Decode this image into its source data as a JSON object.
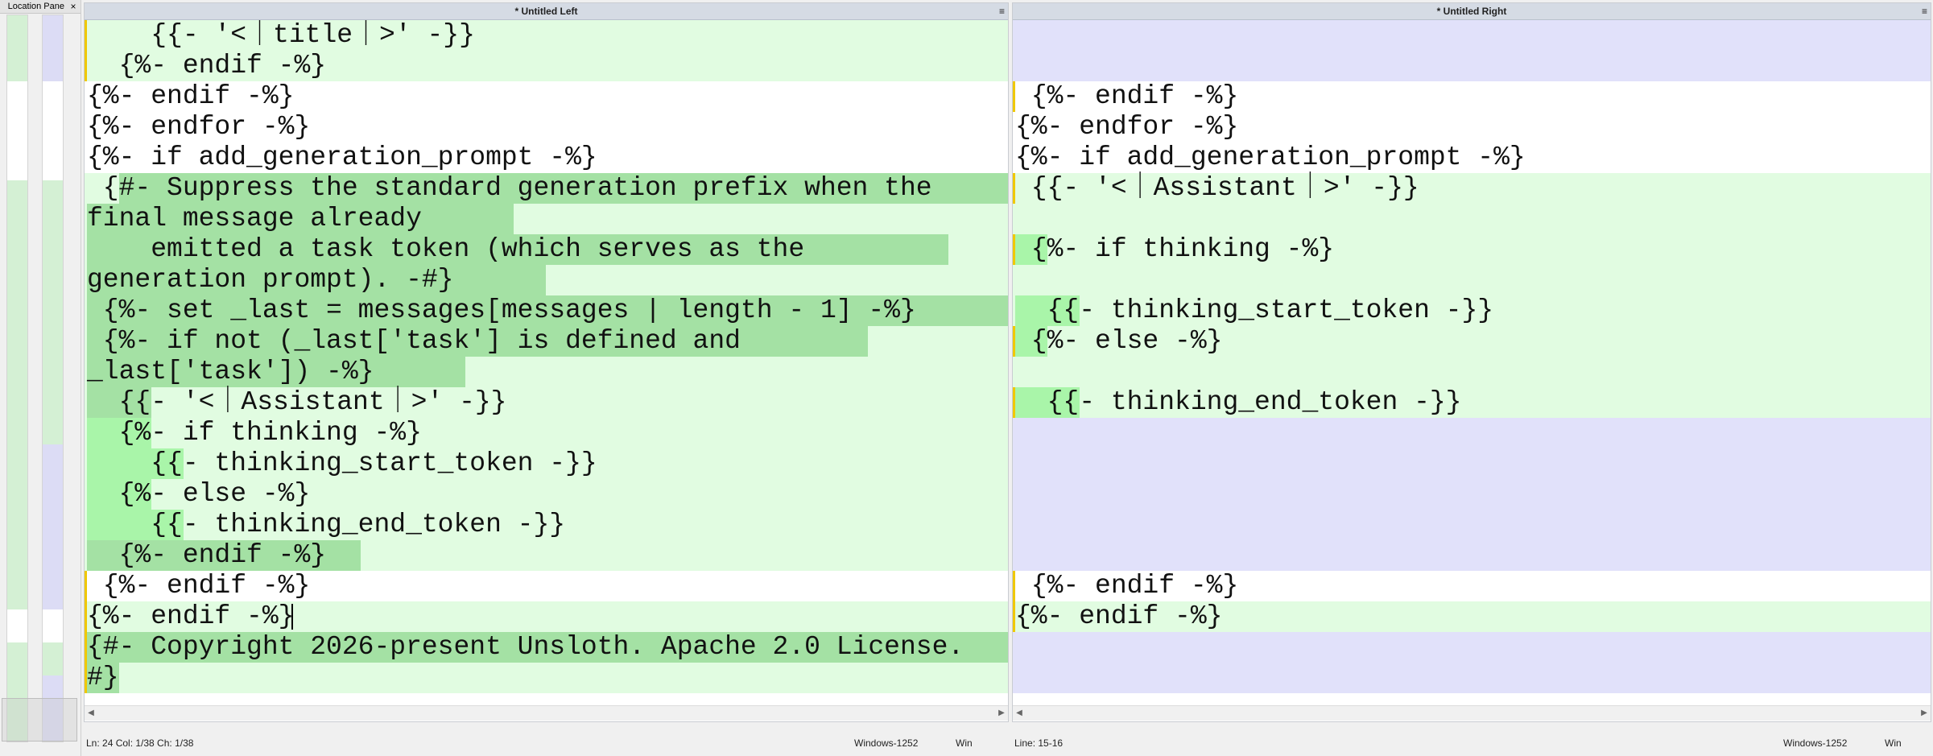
{
  "location_pane": {
    "title": "Location Pane",
    "close_glyph": "×"
  },
  "left_pane": {
    "title": "* Untitled Left",
    "menu_glyph": "≡",
    "lines": [
      "    {{- '<｜title｜>' -}}",
      "  {%- endif -%}",
      "{%- endif -%}",
      "{%- endfor -%}",
      "{%- if add_generation_prompt -%}",
      " {#- Suppress the standard generation prefix when the",
      "final message already",
      "    emitted a task token (which serves as the",
      "generation prompt). -#}",
      " {%- set _last = messages[messages | length - 1] -%}",
      " {%- if not (_last['task'] is defined and",
      "_last['task']) -%}",
      "  {{- '<｜Assistant｜>' -}}",
      "  {%- if thinking -%}",
      "    {{- thinking_start_token -}}",
      "  {%- else -%}",
      "    {{- thinking_end_token -}}",
      "  {%- endif -%}",
      " {%- endif -%}",
      "{%- endif -%}",
      "{#- Copyright 2026-present Unsloth. Apache 2.0 License.",
      "#}"
    ],
    "status": {
      "position": "Ln: 24  Col: 1/38  Ch: 1/38",
      "encoding": "Windows-1252",
      "line_endings": "Win"
    }
  },
  "right_pane": {
    "title": "* Untitled Right",
    "menu_glyph": "≡",
    "lines": [
      "",
      "",
      " {%- endif -%}",
      "{%- endfor -%}",
      "{%- if add_generation_prompt -%}",
      " {{- '<｜Assistant｜>' -}}",
      "",
      " {%- if thinking -%}",
      "",
      "  {{- thinking_start_token -}}",
      " {%- else -%}",
      "",
      "  {{- thinking_end_token -}}",
      "",
      "",
      "",
      "",
      "",
      " {%- endif -%}",
      "{%- endif -%}",
      "",
      ""
    ],
    "status": {
      "position": "Line: 15-16",
      "encoding": "Windows-1252",
      "line_endings": "Win"
    }
  },
  "colors": {
    "changed_line": "#e1fce1",
    "changed_text": "#a4e1a4",
    "inserted": "#a9f5a9",
    "missing": "#e1e1fa",
    "margin_marker": "#f0c800"
  }
}
